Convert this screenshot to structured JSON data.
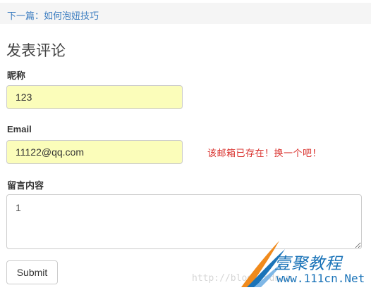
{
  "navigation": {
    "next_post": "下一篇：如何泡妞技巧"
  },
  "comment_form": {
    "title": "发表评论",
    "nickname_label": "昵称",
    "nickname_value": "123",
    "email_label": "Email",
    "email_value": "11122@qq.com",
    "email_error": "该邮箱已存在！换一个吧！",
    "message_label": "留言内容",
    "message_value": "1",
    "submit_label": "Submit"
  },
  "watermark": {
    "url_text": "http://blog.csdn.n",
    "brand": "壹聚教程",
    "site": "www.111cn.Net"
  },
  "colors": {
    "link": "#3a7cc0",
    "autofill_bg": "#fbfdba",
    "error": "#d9302c",
    "watermark_blue": "#1a73b8",
    "watermark_orange": "#f08a1c"
  }
}
